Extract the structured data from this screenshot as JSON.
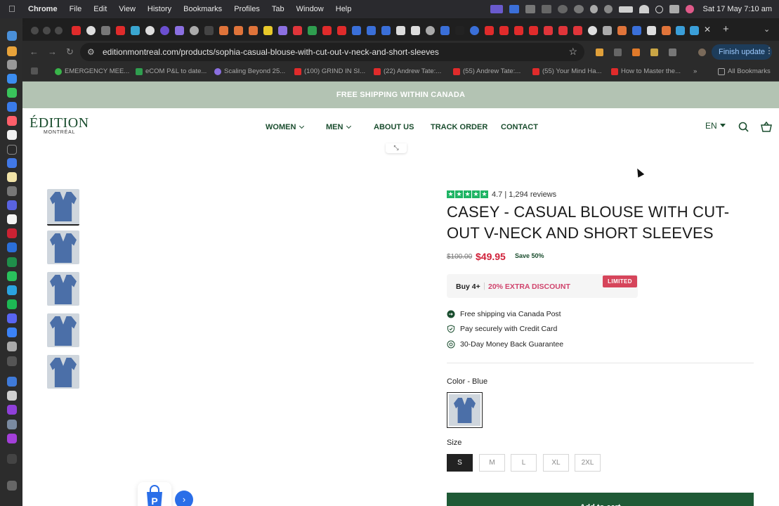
{
  "menubar": {
    "app": "Chrome",
    "items": [
      "File",
      "Edit",
      "View",
      "History",
      "Bookmarks",
      "Profiles",
      "Tab",
      "Window",
      "Help"
    ],
    "clock": "Sat 17 May  7:10 am"
  },
  "browser": {
    "url": "editionmontreal.com/products/sophia-casual-blouse-with-cut-out-v-neck-and-short-sleeves",
    "finish_update": "Finish update",
    "bookmarks": [
      "EMERGENCY MEE...",
      "eCOM P&L to date...",
      "Scaling Beyond 25...",
      "(100) GRIND IN SI...",
      "(22) Andrew Tate:...",
      "(55) Andrew Tate:...",
      "(55) Your Mind Ha...",
      "How to Master the..."
    ],
    "all_bookmarks": "All Bookmarks"
  },
  "site": {
    "announcement": "FREE SHIPPING WITHIN CANADA",
    "logo_main": "ÉDITION",
    "logo_sub": "MONTRÉAL",
    "nav": [
      "WOMEN",
      "MEN",
      "ABOUT US",
      "TRACK ORDER",
      "CONTACT"
    ],
    "language": "EN"
  },
  "product": {
    "rating": "4.7 | 1,294 reviews",
    "rating_stars": 5,
    "title": "CASEY - CASUAL BLOUSE WITH CUT-OUT V-NECK AND SHORT SLEEVES",
    "old_price": "$100.00",
    "price": "$49.95",
    "save": "Save 50%",
    "bundle_left": "Buy 4+",
    "bundle_right": "20% EXTRA DISCOUNT",
    "bundle_badge": "LIMITED",
    "perks": [
      "Free shipping via Canada Post",
      "Pay securely with Credit Card",
      "30-Day Money Back Guarantee"
    ],
    "color_label": "Color - Blue",
    "size_label": "Size",
    "sizes": [
      "S",
      "M",
      "L",
      "XL",
      "2XL"
    ],
    "selected_size": "S",
    "add_to_cart": "Add to cart"
  },
  "colors": {
    "brand_green": "#1a4d2e",
    "sale_red": "#d0213a",
    "announcement_bg": "#b3c3b3",
    "cart_bg": "#1f5a36"
  }
}
